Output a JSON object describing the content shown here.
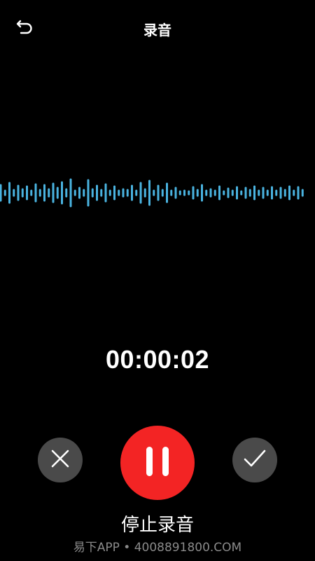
{
  "header": {
    "title": "录音",
    "back_icon": "back-arrow-icon"
  },
  "waveform": {
    "color": "#4ab3e0"
  },
  "recorder": {
    "elapsed": "00:00:02",
    "state": "recording"
  },
  "controls": {
    "cancel_icon": "close-icon",
    "pause_icon": "pause-icon",
    "confirm_icon": "checkmark-icon",
    "action_label": "停止录音",
    "pause_color": "#f32424",
    "secondary_color": "#4a4a4a"
  },
  "watermark": {
    "text": "易下APP • 4008891800.COM"
  }
}
